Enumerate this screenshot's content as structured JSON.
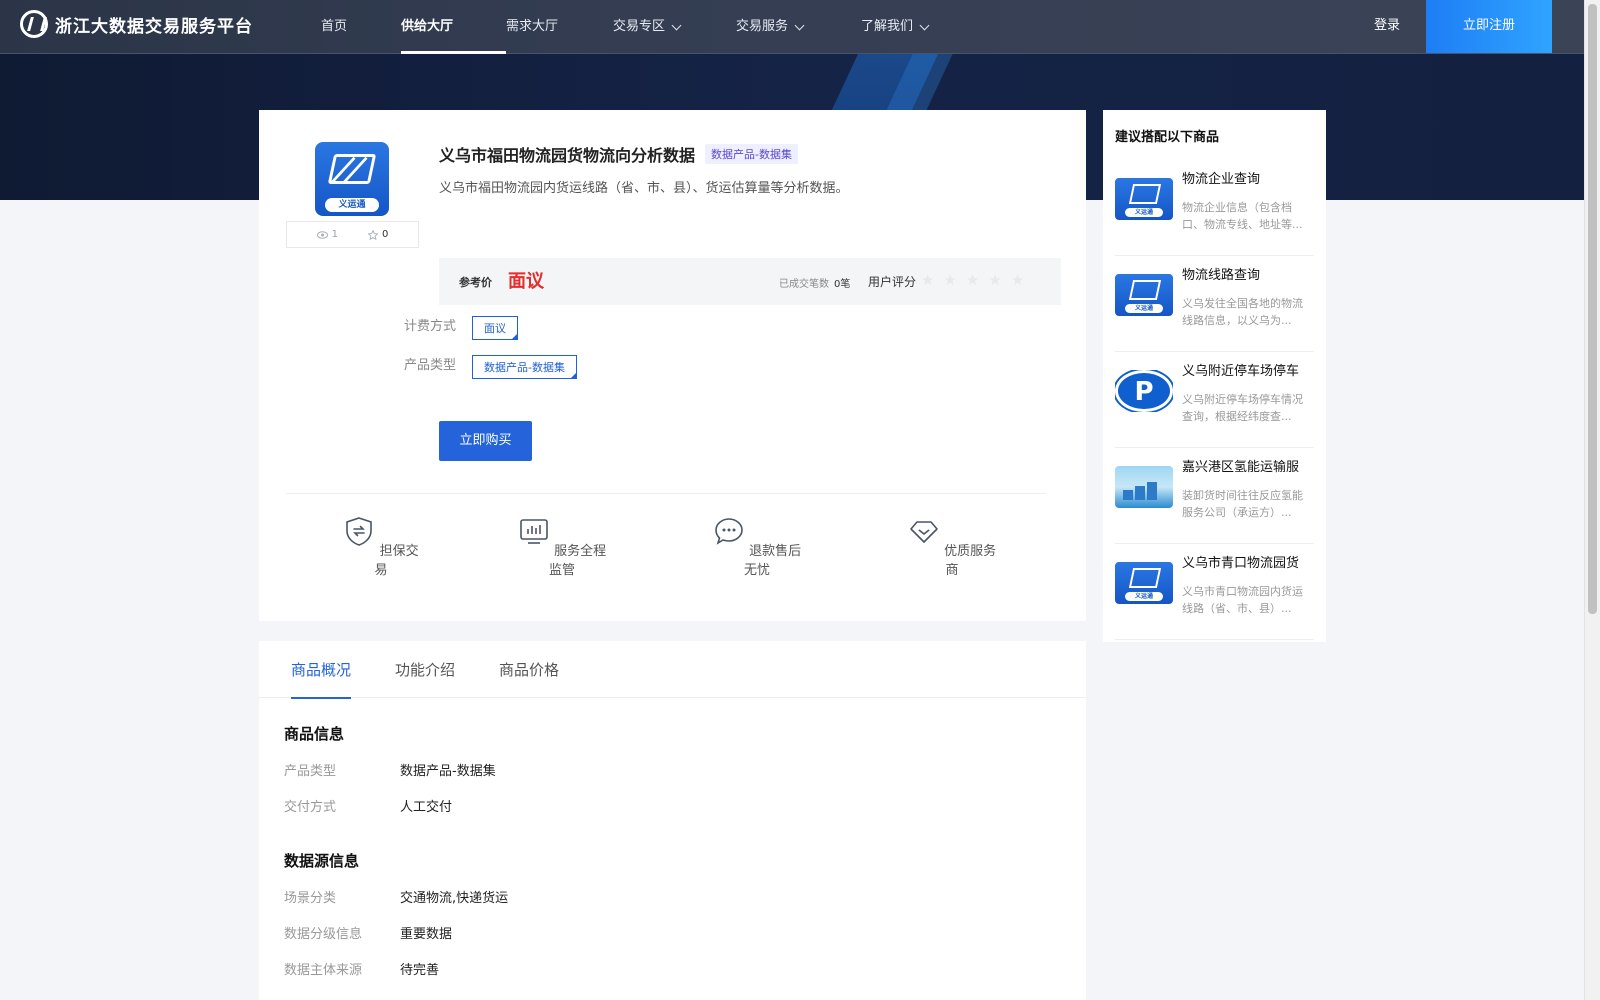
{
  "header": {
    "logo_text": "浙江大数据交易服务平台",
    "nav": [
      {
        "label": "首页",
        "active": false,
        "dropdown": false
      },
      {
        "label": "供给大厅",
        "active": true,
        "dropdown": false
      },
      {
        "label": "需求大厅",
        "active": false,
        "dropdown": false
      },
      {
        "label": "交易专区",
        "active": false,
        "dropdown": true
      },
      {
        "label": "交易服务",
        "active": false,
        "dropdown": true
      },
      {
        "label": "了解我们",
        "active": false,
        "dropdown": true
      }
    ],
    "login_label": "登录",
    "register_label": "立即注册"
  },
  "product": {
    "logo_brand": "义运通",
    "views": "1",
    "favorites": "0",
    "title": "义乌市福田物流园货物流向分析数据",
    "tag": "数据产品-数据集",
    "description": "义乌市福田物流园内货运线路（省、市、县）、货运估算量等分析数据。",
    "price_label": "参考价",
    "price_value": "面议",
    "deal_label": "已成交笔数",
    "deal_count": "0笔",
    "rating_label": "用户评分",
    "rating": 0,
    "billing_label": "计费方式",
    "billing_value": "面议",
    "type_label": "产品类型",
    "type_value": "数据产品-数据集",
    "buy_label": "立即购买"
  },
  "features": [
    {
      "label": "担保交易",
      "icon": "shield-exchange-icon"
    },
    {
      "label": "服务全程监管",
      "icon": "monitor-chart-icon"
    },
    {
      "label": "退款售后无忧",
      "icon": "chat-bubble-icon"
    },
    {
      "label": "优质服务商",
      "icon": "diamond-icon"
    }
  ],
  "tabs": [
    {
      "label": "商品概况",
      "active": true
    },
    {
      "label": "功能介绍",
      "active": false
    },
    {
      "label": "商品价格",
      "active": false
    }
  ],
  "product_info": {
    "title": "商品信息",
    "rows": [
      {
        "key": "产品类型",
        "value": "数据产品-数据集"
      },
      {
        "key": "交付方式",
        "value": "人工交付"
      }
    ]
  },
  "source_info": {
    "title": "数据源信息",
    "rows": [
      {
        "key": "场景分类",
        "value": "交通物流,快递货运"
      },
      {
        "key": "数据分级信息",
        "value": "重要数据"
      },
      {
        "key": "数据主体来源",
        "value": "待完善"
      }
    ]
  },
  "sidebar": {
    "title": "建议搭配以下商品",
    "items": [
      {
        "name": "物流企业查询",
        "desc": "物流企业信息（包含档口、物流专线、地址等...",
        "thumb": "brand",
        "thumb_brand": "义运通"
      },
      {
        "name": "物流线路查询",
        "desc": "义乌发往全国各地的物流线路信息，以义乌为...",
        "thumb": "brand",
        "thumb_brand": "义运通"
      },
      {
        "name": "义乌附近停车场停车",
        "desc": "义乌附近停车场停车情况查询，根据经纬度查...",
        "thumb": "parking",
        "thumb_letter": "P"
      },
      {
        "name": "嘉兴港区氢能运输服",
        "desc": "装卸货时间往往反应氢能服务公司（承运方）...",
        "thumb": "port"
      },
      {
        "name": "义乌市青口物流园货",
        "desc": "义乌市青口物流园内货运线路（省、市、县）...",
        "thumb": "brand",
        "thumb_brand": "义运通"
      }
    ]
  },
  "colors": {
    "primary": "#2463d9",
    "price": "#e62c2c",
    "tag_bg": "#eef0ff",
    "tag_fg": "#5b46c9"
  }
}
